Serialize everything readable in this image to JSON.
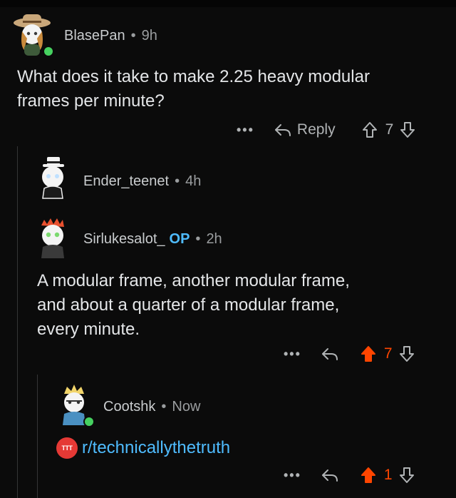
{
  "comments": [
    {
      "username": "BlasePan",
      "time": "9h",
      "body_lines": [
        "What does it take to make 2.25 heavy modular",
        "frames per minute?"
      ],
      "actions": {
        "more": "•••",
        "reply": "Reply",
        "score": "7"
      }
    },
    {
      "username": "Ender_teenet",
      "time": "4h"
    },
    {
      "username": "Sirlukesalot_",
      "op_badge": "OP",
      "time": "2h",
      "body_lines": [
        "A modular frame, another modular frame,",
        "and about a quarter of a modular frame,",
        "every minute."
      ],
      "actions": {
        "more": "•••",
        "score": "7"
      }
    },
    {
      "username": "Cootshk",
      "time": "Now",
      "subreddit_link": "r/technicallythetruth",
      "subreddit_icon_text": "TTT",
      "actions": {
        "more": "•••",
        "score": "1"
      }
    }
  ],
  "colors": {
    "background": "#0b0b0b",
    "upvote_active": "#ff4500",
    "link": "#4fbcff",
    "op_badge": "#4fbcff",
    "online": "#46d160"
  },
  "separator": "•"
}
